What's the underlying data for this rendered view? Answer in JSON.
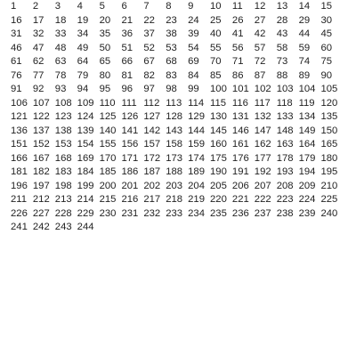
{
  "grid": {
    "start": 1,
    "end": 244,
    "columns": 15,
    "values": [
      "1",
      "2",
      "3",
      "4",
      "5",
      "6",
      "7",
      "8",
      "9",
      "10",
      "11",
      "12",
      "13",
      "14",
      "15",
      "16",
      "17",
      "18",
      "19",
      "20",
      "21",
      "22",
      "23",
      "24",
      "25",
      "26",
      "27",
      "28",
      "29",
      "30",
      "31",
      "32",
      "33",
      "34",
      "35",
      "36",
      "37",
      "38",
      "39",
      "40",
      "41",
      "42",
      "43",
      "44",
      "45",
      "46",
      "47",
      "48",
      "49",
      "50",
      "51",
      "52",
      "53",
      "54",
      "55",
      "56",
      "57",
      "58",
      "59",
      "60",
      "61",
      "62",
      "63",
      "64",
      "65",
      "66",
      "67",
      "68",
      "69",
      "70",
      "71",
      "72",
      "73",
      "74",
      "75",
      "76",
      "77",
      "78",
      "79",
      "80",
      "81",
      "82",
      "83",
      "84",
      "85",
      "86",
      "87",
      "88",
      "89",
      "90",
      "91",
      "92",
      "93",
      "94",
      "95",
      "96",
      "97",
      "98",
      "99",
      "100",
      "101",
      "102",
      "103",
      "104",
      "105",
      "106",
      "107",
      "108",
      "109",
      "110",
      "111",
      "112",
      "113",
      "114",
      "115",
      "116",
      "117",
      "118",
      "119",
      "120",
      "121",
      "122",
      "123",
      "124",
      "125",
      "126",
      "127",
      "128",
      "129",
      "130",
      "131",
      "132",
      "133",
      "134",
      "135",
      "136",
      "137",
      "138",
      "139",
      "140",
      "141",
      "142",
      "143",
      "144",
      "145",
      "146",
      "147",
      "148",
      "149",
      "150",
      "151",
      "152",
      "153",
      "154",
      "155",
      "156",
      "157",
      "158",
      "159",
      "160",
      "161",
      "162",
      "163",
      "164",
      "165",
      "166",
      "167",
      "168",
      "169",
      "170",
      "171",
      "172",
      "173",
      "174",
      "175",
      "176",
      "177",
      "178",
      "179",
      "180",
      "181",
      "182",
      "183",
      "184",
      "185",
      "186",
      "187",
      "188",
      "189",
      "190",
      "191",
      "192",
      "193",
      "194",
      "195",
      "196",
      "197",
      "198",
      "199",
      "200",
      "201",
      "202",
      "203",
      "204",
      "205",
      "206",
      "207",
      "208",
      "209",
      "210",
      "211",
      "212",
      "213",
      "214",
      "215",
      "216",
      "217",
      "218",
      "219",
      "220",
      "221",
      "222",
      "223",
      "224",
      "225",
      "226",
      "227",
      "228",
      "229",
      "230",
      "231",
      "232",
      "233",
      "234",
      "235",
      "236",
      "237",
      "238",
      "239",
      "240",
      "241",
      "242",
      "243",
      "244"
    ]
  }
}
